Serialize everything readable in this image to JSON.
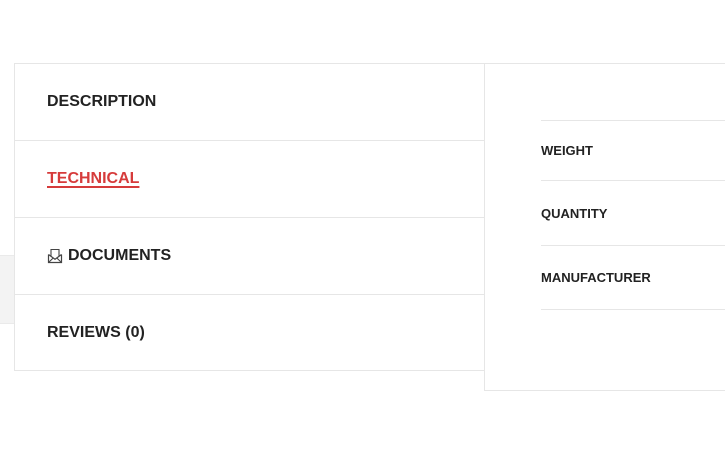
{
  "tabs": [
    {
      "label": "DESCRIPTION",
      "active": false
    },
    {
      "label": "TECHNICAL",
      "active": true
    },
    {
      "label": "DOCUMENTS",
      "icon": "document-icon",
      "active": false
    },
    {
      "label": "REVIEWS (0)",
      "active": false
    }
  ],
  "specs": {
    "rows": [
      {
        "label": "WEIGHT"
      },
      {
        "label": "QUANTITY"
      },
      {
        "label": "MANUFACTURER"
      }
    ]
  },
  "colors": {
    "active_tab": "#d63b3b",
    "text": "#222222",
    "border": "#e6e6e6"
  }
}
